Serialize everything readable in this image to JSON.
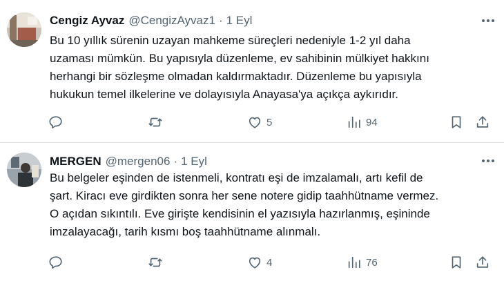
{
  "tweets": [
    {
      "name": "Cengiz Ayvaz",
      "handle": "@CengizAyvaz1",
      "separator": "·",
      "date": "1 Eyl",
      "text_lines": [
        "Bu 10 yıllık sürenin uzayan mahkeme süreçleri nedeniyle 1-2 yıl daha",
        "uzaması mümkün. Bu yapısıyla düzenleme, ev sahibinin mülkiyet hakkını",
        "herhangi bir sözleşme olmadan kaldırmaktadır. Düzenleme bu yapısıyla",
        "hukukun temel ilkelerine ve dolayısıyla Anayasa'ya açıkça aykırıdır."
      ],
      "likes": "5",
      "views": "94"
    },
    {
      "name": "MERGEN",
      "handle": "@mergen06",
      "separator": "·",
      "date": "1 Eyl",
      "text_lines": [
        "Bu belgeler eşinden de istenmeli, kontratı eşi de imzalamalı, artı kefil de",
        "şart. Kiracı eve girdikten sonra her sene notere gidip taahhütname vermez.",
        "O açıdan sıkıntılı. Eve girişte kendisinin el yazısıyla hazırlanmış, eşininde",
        "imzalayacağı, tarih kısmı boş taahhütname alınmalı."
      ],
      "likes": "4",
      "views": "76"
    }
  ],
  "icons": {
    "reply": "reply-icon",
    "retweet": "retweet-icon",
    "like": "heart-icon",
    "views": "views-icon",
    "bookmark": "bookmark-icon",
    "share": "share-icon",
    "more": "more-icon"
  },
  "colors": {
    "text": "#0f1419",
    "secondary": "#536471",
    "divider": "#e1e6ea"
  }
}
